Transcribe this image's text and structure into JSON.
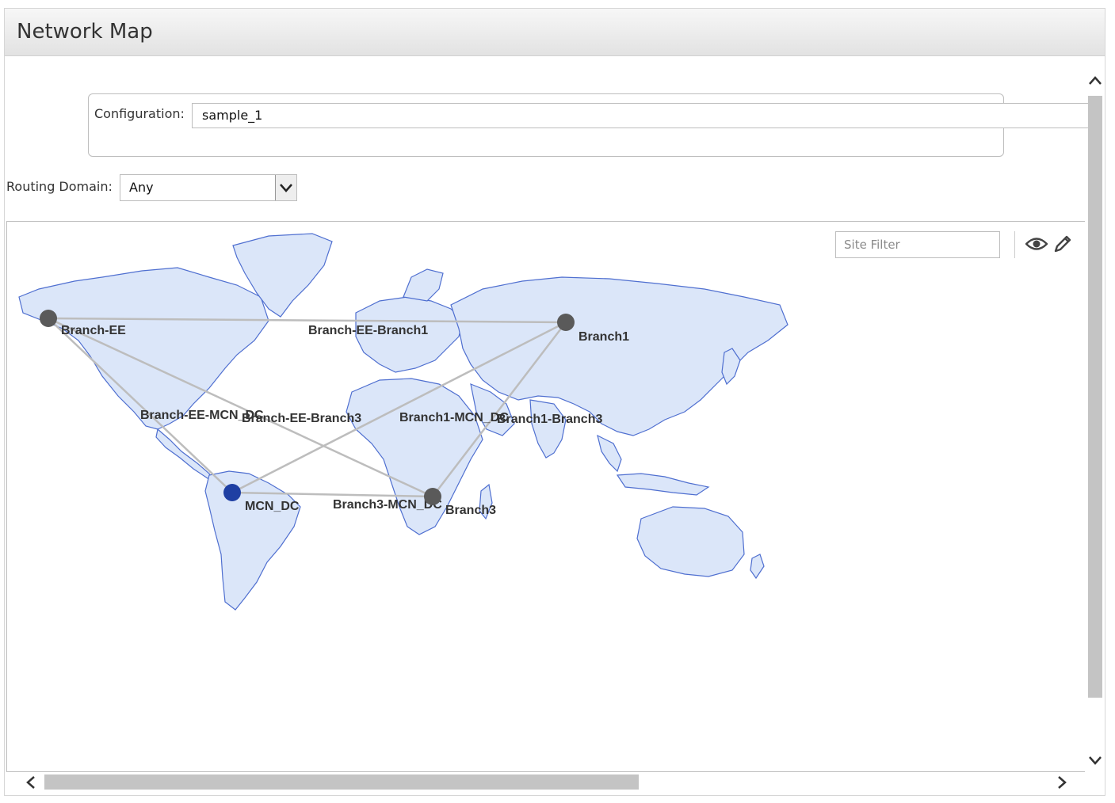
{
  "header": {
    "title": "Network Map"
  },
  "configuration": {
    "label": "Configuration:",
    "value": "sample_1"
  },
  "routing_domain": {
    "label": "Routing Domain:",
    "selected": "Any"
  },
  "toolbar": {
    "site_filter_placeholder": "Site Filter",
    "view_icon": "eye-icon",
    "edit_icon": "pencil-icon"
  },
  "colors": {
    "map_fill": "#dbe6f9",
    "map_stroke": "#4f6fd0",
    "site_node": "#5a5a5a",
    "mcn_node": "#1f3fa3",
    "link": "#bdbdbd"
  },
  "sites": [
    {
      "name": "Branch-EE",
      "type": "branch"
    },
    {
      "name": "Branch1",
      "type": "branch"
    },
    {
      "name": "MCN_DC",
      "type": "mcn"
    },
    {
      "name": "Branch3",
      "type": "branch"
    }
  ],
  "links": [
    {
      "name": "Branch-EE-Branch1"
    },
    {
      "name": "Branch-EE-MCN_DC"
    },
    {
      "name": "Branch-EE-Branch3"
    },
    {
      "name": "Branch1-MCN_DC"
    },
    {
      "name": "Branch1-Branch3"
    },
    {
      "name": "Branch3-MCN_DC"
    }
  ]
}
